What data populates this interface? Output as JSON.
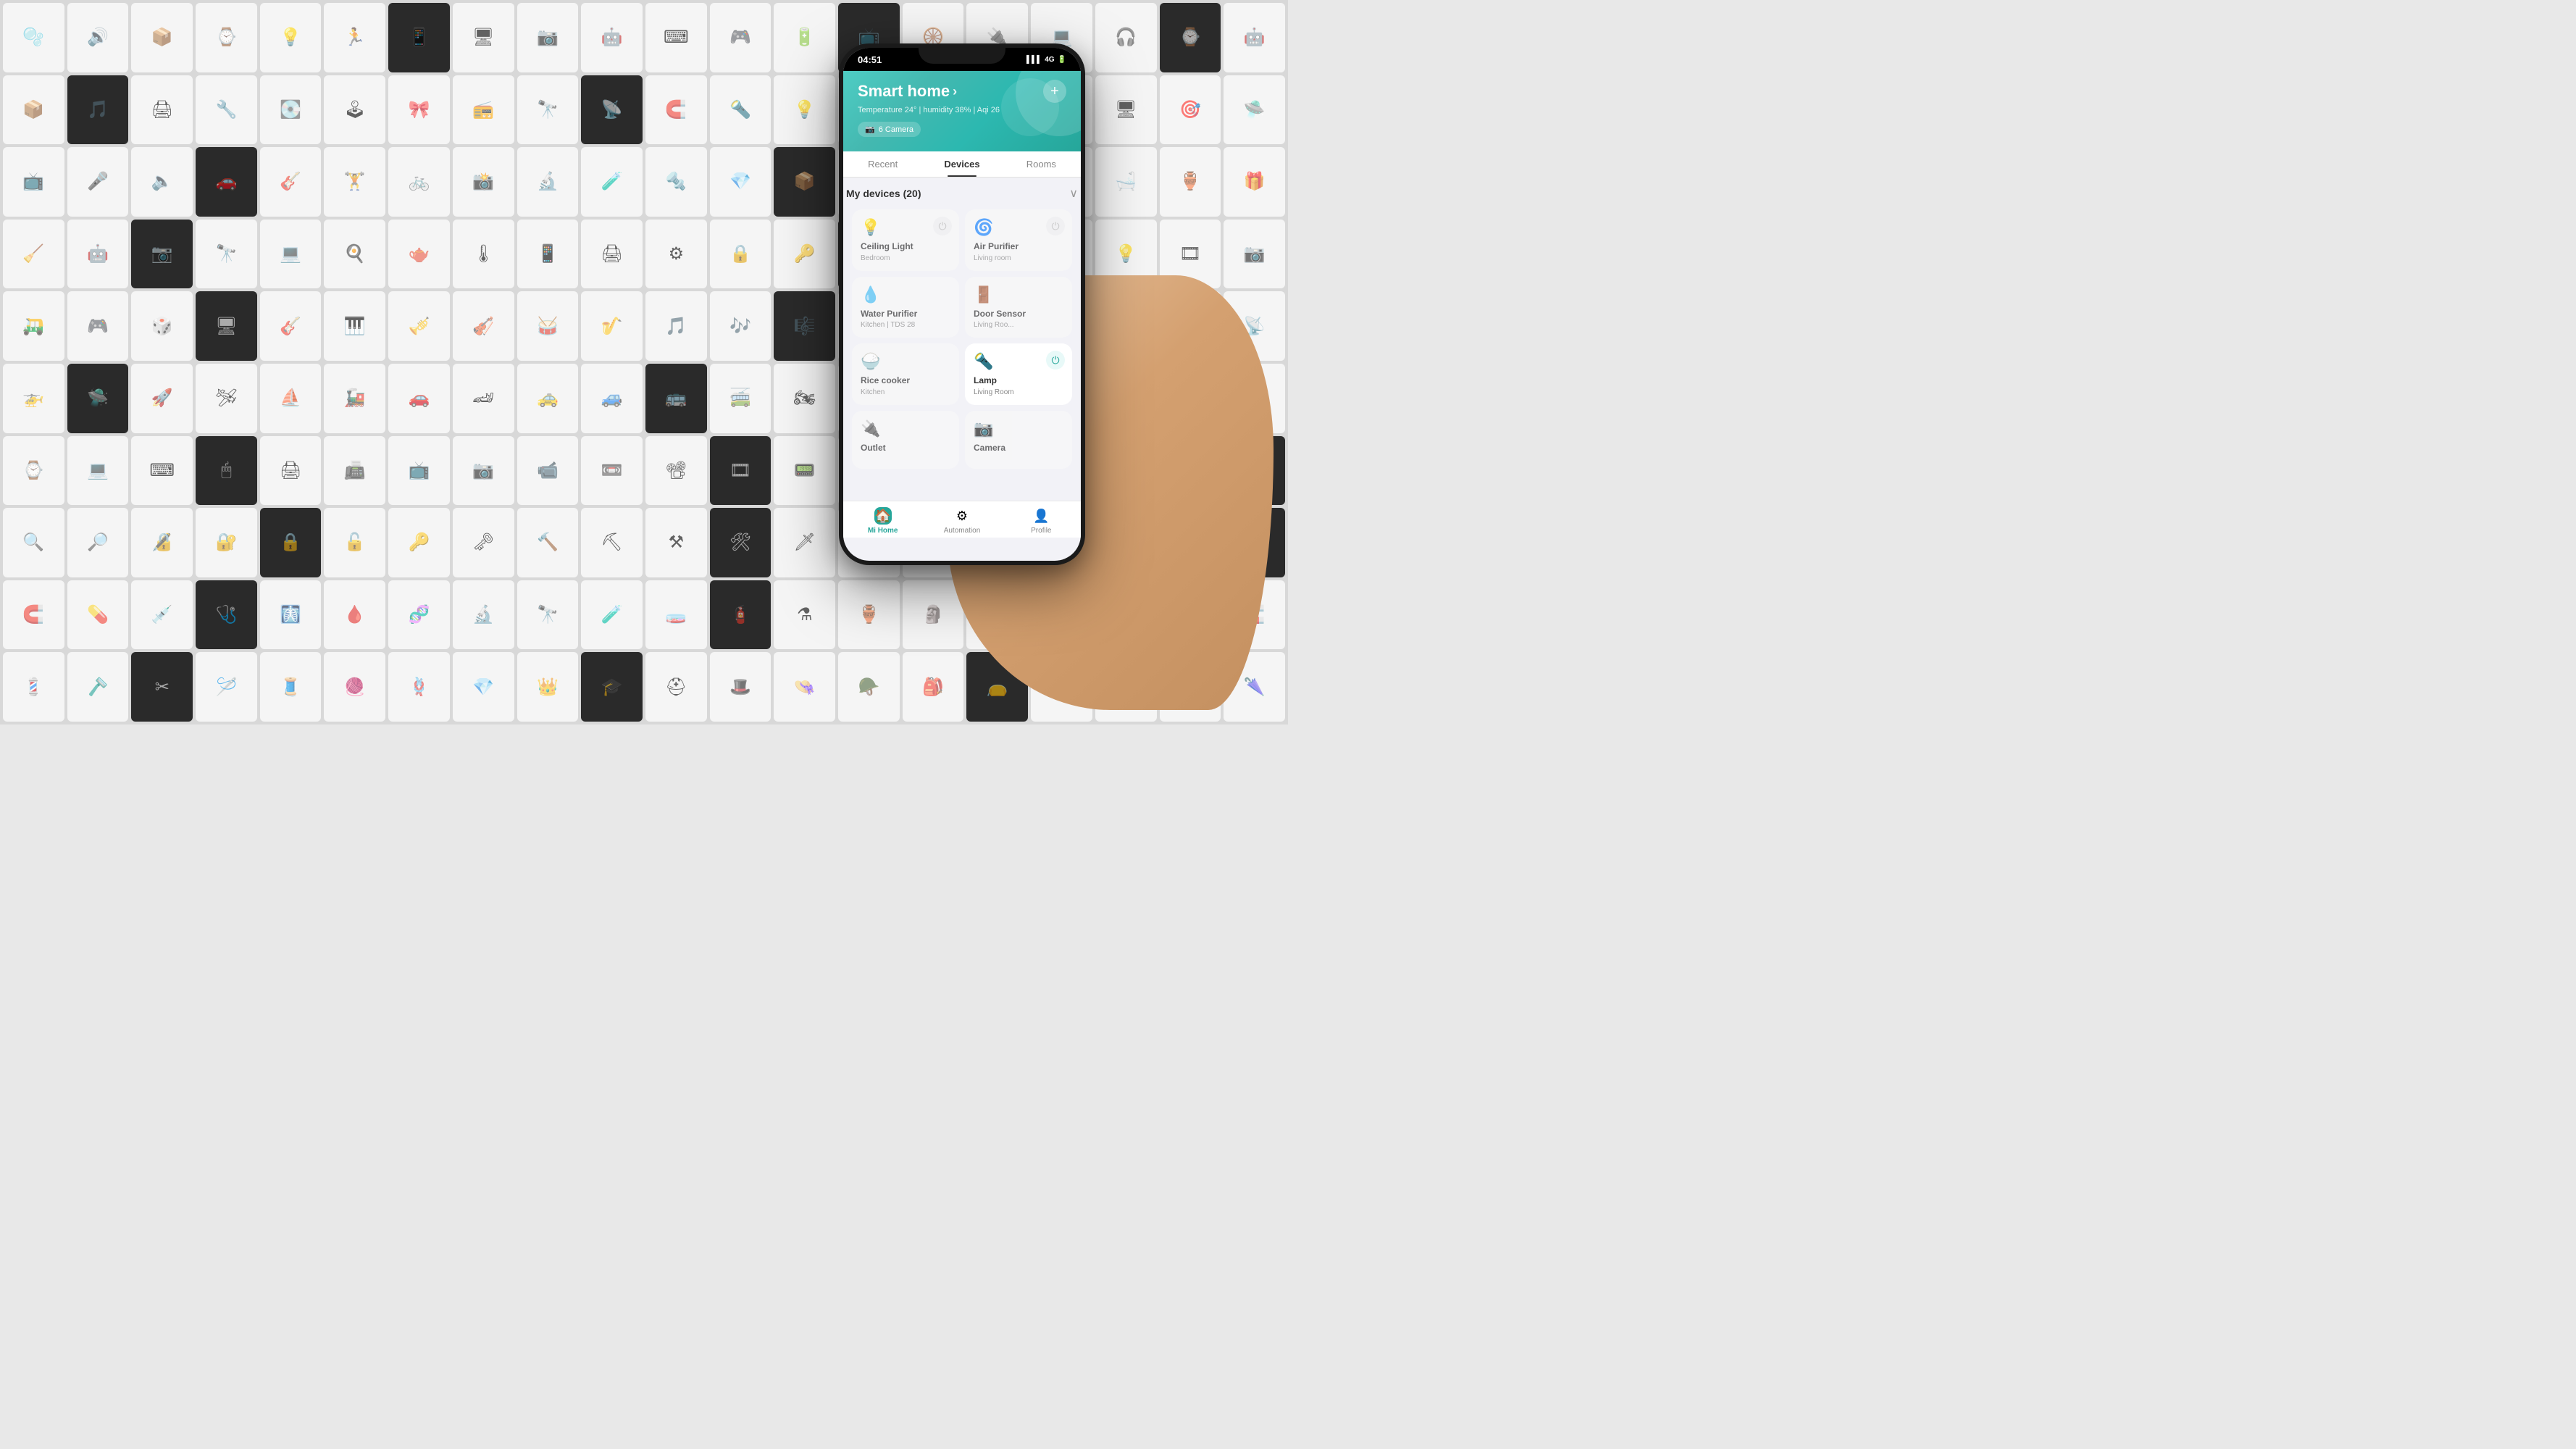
{
  "background": {
    "description": "Collage of smart home devices",
    "cells": [
      {
        "icon": "🫧",
        "bg": "white"
      },
      {
        "icon": "📷",
        "bg": "dark"
      },
      {
        "icon": "🎧",
        "bg": "white"
      },
      {
        "icon": "⌚",
        "bg": "white"
      },
      {
        "icon": "💡",
        "bg": "white"
      },
      {
        "icon": "🏃",
        "bg": "white"
      },
      {
        "icon": "📱",
        "bg": "dark"
      },
      {
        "icon": "🤖",
        "bg": "white"
      },
      {
        "icon": "🔌",
        "bg": "white"
      },
      {
        "icon": "🖥",
        "bg": "white"
      },
      {
        "icon": "🎮",
        "bg": "white"
      },
      {
        "icon": "🔋",
        "bg": "white"
      }
    ]
  },
  "phone": {
    "status_bar": {
      "time": "04:51",
      "signal": "4G",
      "battery": "■■■"
    },
    "header": {
      "title": "Smart home",
      "subtitle": "Temperature 24° | humidity 38% | Aqi 26",
      "add_button": "+",
      "camera_count": "6 Camera"
    },
    "tabs": [
      {
        "label": "Recent",
        "active": false
      },
      {
        "label": "Devices",
        "active": true
      },
      {
        "label": "Rooms",
        "active": false
      }
    ],
    "devices_section": {
      "title": "My devices",
      "count": "(20)",
      "devices": [
        {
          "name": "Ceiling Light",
          "sub": "Bedroom",
          "icon": "💡",
          "power": "off",
          "active": false
        },
        {
          "name": "Air Purifier",
          "sub": "Living room",
          "icon": "🌀",
          "power": "off",
          "active": false
        },
        {
          "name": "Water Purifier",
          "sub": "Kitchen | TDS 28",
          "icon": "💧",
          "power": "off",
          "active": false
        },
        {
          "name": "Door Sensor",
          "sub": "Living Roo...",
          "icon": "🚪",
          "power": "off",
          "active": false
        },
        {
          "name": "Rice cooker",
          "sub": "Kitchen",
          "icon": "🍚",
          "power": "off",
          "active": false
        },
        {
          "name": "Lamp",
          "sub": "Living Room",
          "icon": "🔦",
          "power": "on",
          "active": true
        },
        {
          "name": "Outlet",
          "sub": "",
          "icon": "🔌",
          "power": "off",
          "active": false
        },
        {
          "name": "Camera",
          "sub": "",
          "icon": "📷",
          "power": "off",
          "active": false
        }
      ]
    },
    "bottom_nav": [
      {
        "label": "Mi Home",
        "icon": "🏠",
        "active": true
      },
      {
        "label": "Automation",
        "icon": "⚙",
        "active": false
      },
      {
        "label": "Profile",
        "icon": "👤",
        "active": false
      }
    ]
  }
}
